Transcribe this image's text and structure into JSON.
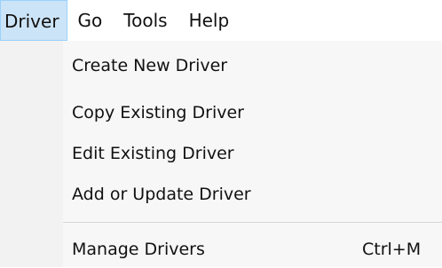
{
  "menubar": {
    "items": [
      {
        "label": "Driver",
        "active": true
      },
      {
        "label": "Go"
      },
      {
        "label": "Tools"
      },
      {
        "label": "Help"
      }
    ]
  },
  "dropdown": {
    "items": [
      {
        "label": "Create New Driver",
        "shortcut": ""
      },
      {
        "label": "Copy Existing Driver",
        "shortcut": ""
      },
      {
        "label": "Edit Existing Driver",
        "shortcut": ""
      },
      {
        "label": "Add or Update Driver",
        "shortcut": ""
      },
      {
        "label": "Manage Drivers",
        "shortcut": "Ctrl+M"
      }
    ]
  },
  "colors": {
    "active_menu_bg": "#cce4f7",
    "active_menu_border": "#99d1ff",
    "dropdown_bg": "#f2f2f2"
  }
}
